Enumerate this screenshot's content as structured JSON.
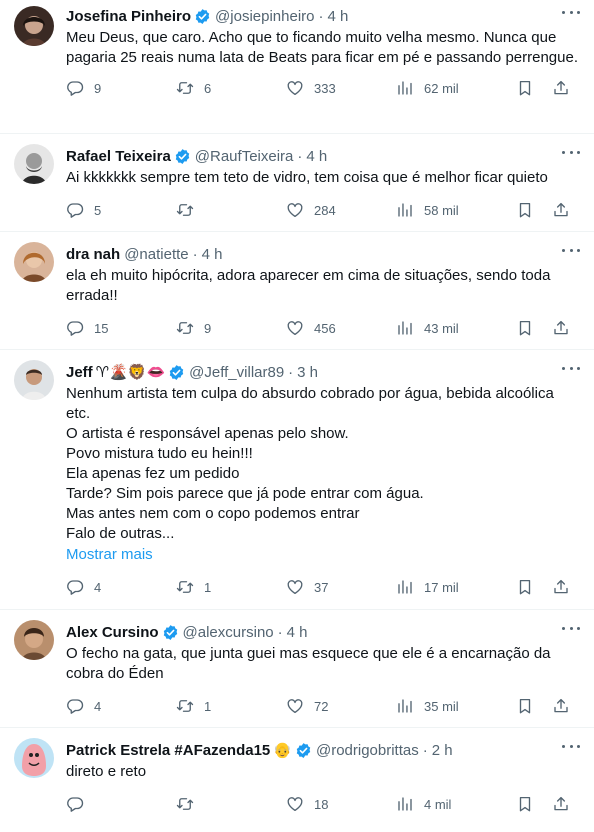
{
  "tweets": [
    {
      "name": "Josefina Pinheiro",
      "handle": "@josiepinheiro",
      "separator": "·",
      "time": "4 h",
      "emojis": "",
      "text": "Meu Deus, que caro. Acho que to ficando muito velha mesmo. Nunca que pagaria 25 reais numa lata de Beats para ficar em pé e passando perrengue.",
      "show_more": "",
      "replies": "9",
      "retweets": "6",
      "likes": "333",
      "views": "62 mil"
    },
    {
      "name": "Rafael Teixeira",
      "handle": "@RaufTeixeira",
      "separator": "·",
      "time": "4 h",
      "emojis": "",
      "text": "Ai kkkkkkk sempre tem teto de vidro, tem coisa que é melhor ficar quieto",
      "show_more": "",
      "replies": "5",
      "retweets": "",
      "likes": "284",
      "views": "58 mil"
    },
    {
      "name": "dra nah",
      "handle": "@natiette",
      "separator": "·",
      "time": "4 h",
      "emojis": "",
      "text": "ela eh muito hipócrita, adora aparecer em cima de situações, sendo toda errada!!",
      "show_more": "",
      "replies": "15",
      "retweets": "9",
      "likes": "456",
      "views": "43 mil"
    },
    {
      "name": "Jeff",
      "handle": "@Jeff_villar89",
      "separator": "·",
      "time": "3 h",
      "emojis": "♈🌋🦁👄",
      "text": "Nenhum artista tem culpa do absurdo cobrado por água, bebida alcoólica etc.\nO artista é responsável apenas pelo show.\nPovo mistura tudo eu hein!!!\nEla apenas fez um pedido\nTarde? Sim pois parece que já pode entrar com água.\nMas antes nem com o copo podemos entrar\nFalo de outras...",
      "show_more": "Mostrar mais",
      "replies": "4",
      "retweets": "1",
      "likes": "37",
      "views": "17 mil"
    },
    {
      "name": "Alex Cursino",
      "handle": "@alexcursino",
      "separator": "·",
      "time": "4 h",
      "emojis": "",
      "text": "O fecho na gata, que junta guei mas esquece que ele é a encarnação da cobra do Éden",
      "show_more": "",
      "replies": "4",
      "retweets": "1",
      "likes": "72",
      "views": "35 mil"
    },
    {
      "name": "Patrick Estrela #AFazenda15",
      "handle": "@rodrigobrittas",
      "separator": "·",
      "time": "2 h",
      "emojis": "👴",
      "text": "direto e reto",
      "show_more": "",
      "replies": "",
      "retweets": "",
      "likes": "18",
      "views": "4 mil"
    }
  ],
  "colors": {
    "text": "#0f1419",
    "secondary": "#536471",
    "link": "#1d9bf0",
    "verified": "#1d9bf0",
    "divider": "#eff3f4"
  },
  "icons": [
    "verified-badge-icon",
    "more-icon",
    "reply-icon",
    "retweet-icon",
    "like-icon",
    "views-icon",
    "bookmark-icon",
    "share-icon"
  ]
}
